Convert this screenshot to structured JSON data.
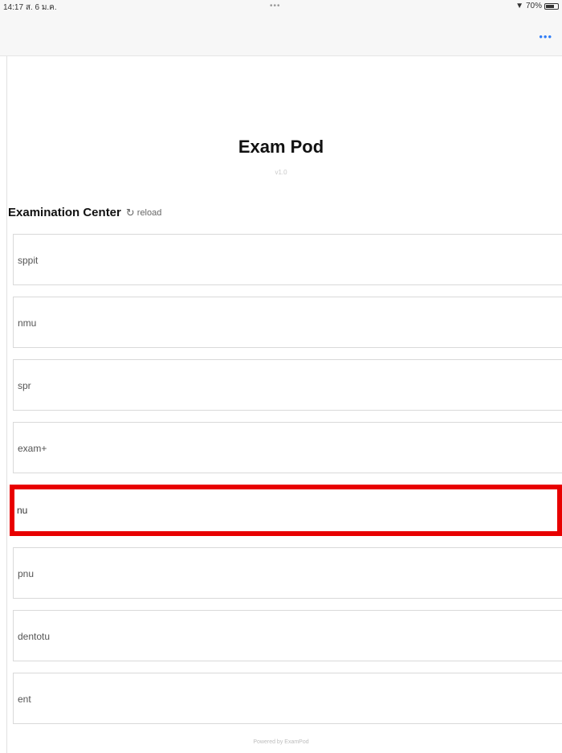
{
  "status_bar": {
    "time": "14:17",
    "date": "ส. 6 ม.ค.",
    "center_dots": "•••",
    "battery_text": "70%"
  },
  "nav": {
    "more_label": "•••"
  },
  "header": {
    "title": "Exam Pod",
    "subtitle": "v1.0"
  },
  "section": {
    "title": "Examination Center",
    "reload_label": "reload"
  },
  "centers": [
    {
      "label": "sppit"
    },
    {
      "label": "nmu"
    },
    {
      "label": "spr"
    },
    {
      "label": "exam+"
    },
    {
      "label": "nu"
    },
    {
      "label": "pnu"
    },
    {
      "label": "dentotu"
    },
    {
      "label": "ent"
    }
  ],
  "highlighted_index": 4,
  "footer": {
    "text": "Powered by ExamPod"
  },
  "colors": {
    "accent": "#2f7cf6",
    "highlight": "#e80000"
  }
}
